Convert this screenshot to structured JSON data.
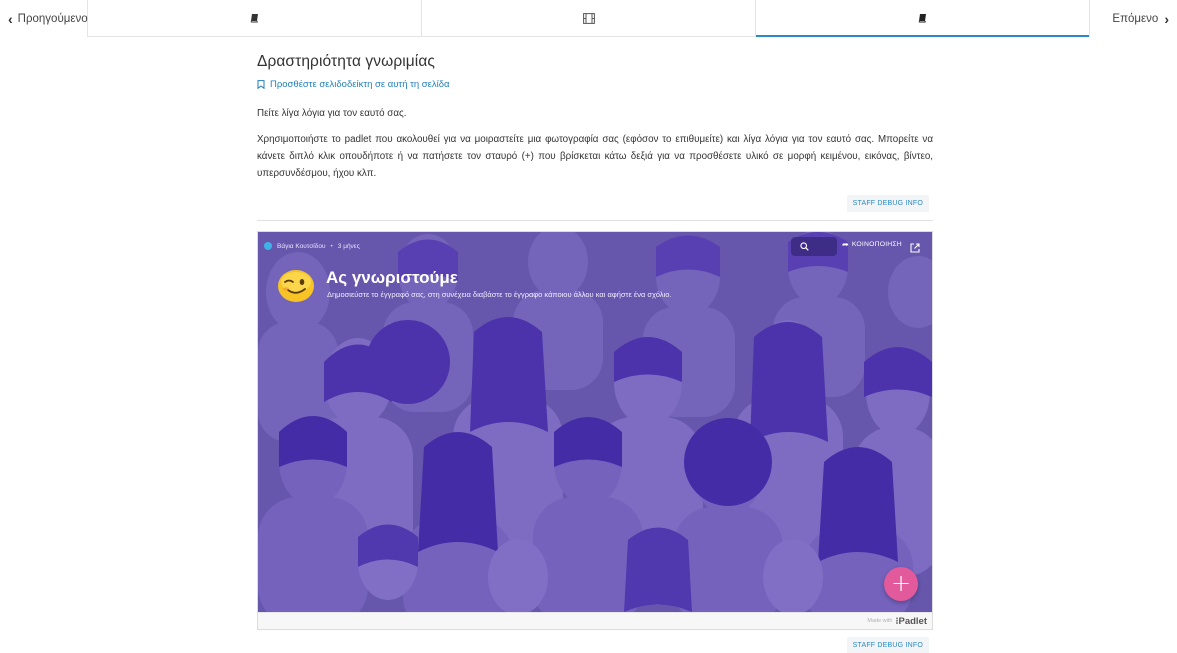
{
  "nav": {
    "prev_label": "Προηγούμενο",
    "next_label": "Επόμενο",
    "tabs": [
      {
        "icon": "book-icon",
        "active": false
      },
      {
        "icon": "film-icon",
        "active": false
      },
      {
        "icon": "book-icon",
        "active": true
      }
    ]
  },
  "page": {
    "title": "Δραστηριότητα γνωριμίας",
    "bookmark_label": "Προσθέστε σελιδοδείκτη σε αυτή τη σελίδα",
    "intro": "Πείτε λίγα λόγια για τον εαυτό σας.",
    "description": "Χρησιμοποιήστε το padlet που ακολουθεί για να μοιραστείτε μια φωτογραφία σας (εφόσον το επιθυμείτε) και λίγα λόγια για τον εαυτό σας. Μπορείτε να κάνετε διπλό κλικ οπουδήποτε ή να πατήσετε τον σταυρό (+) που βρίσκεται κάτω δεξιά για να προσθέσετε υλικό σε μορφή κειμένου, εικόνας, βίντεο, υπερσυνδέσμου, ήχου κλπ.",
    "debug_label": "STAFF DEBUG INFO",
    "debug_label_bottom": "STAFF DEBUG INFO"
  },
  "padlet": {
    "author": "Βάγια Κουτσίδου",
    "time": "3 μήνες",
    "share_label": "ΚΟΙΝΟΠΟΙΗΣΗ",
    "emoji": "winking-face-emoji",
    "title": "Ας γνωριστούμε",
    "subtitle": "Δημοσιεύστε το έγγραφό σας, στη συνέχεια διαβάστε το έγγραφο κάποιου άλλου και αφήστε ένα σχόλιο.",
    "fab_label": "+",
    "made_with": "Made with",
    "brand": "Padlet",
    "colors": {
      "background": "#6b5cb0",
      "fab": "#e35a9c",
      "accent": "#2b8ac6"
    }
  }
}
